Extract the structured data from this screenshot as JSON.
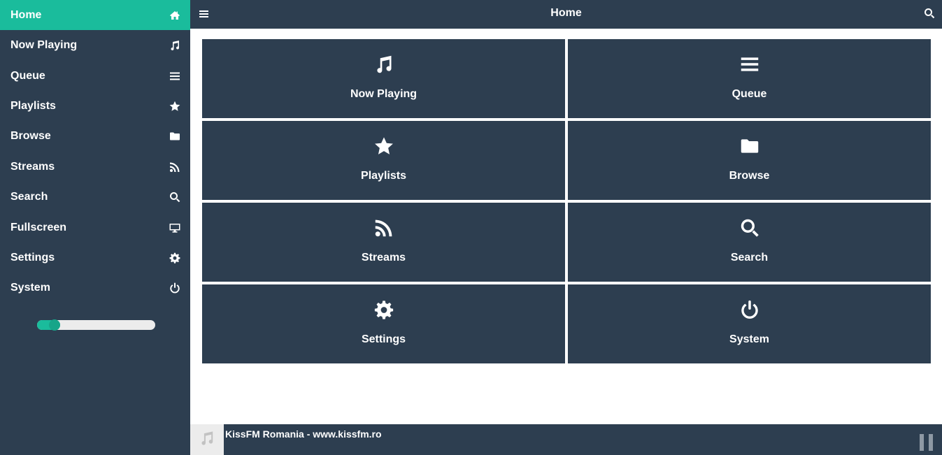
{
  "sidebar": {
    "items": [
      {
        "label": "Home",
        "icon": "home-icon",
        "active": true
      },
      {
        "label": "Now Playing",
        "icon": "music-icon"
      },
      {
        "label": "Queue",
        "icon": "list-icon"
      },
      {
        "label": "Playlists",
        "icon": "star-icon"
      },
      {
        "label": "Browse",
        "icon": "folder-icon"
      },
      {
        "label": "Streams",
        "icon": "rss-icon"
      },
      {
        "label": "Search",
        "icon": "search-icon"
      },
      {
        "label": "Fullscreen",
        "icon": "desktop-icon"
      },
      {
        "label": "Settings",
        "icon": "gear-icon"
      },
      {
        "label": "System",
        "icon": "power-icon"
      }
    ],
    "volume": 0.15
  },
  "header": {
    "title": "Home",
    "menu_icon": "hamburger-icon",
    "search_icon": "search-icon"
  },
  "tiles": [
    {
      "label": "Now Playing",
      "icon": "music-icon"
    },
    {
      "label": "Queue",
      "icon": "list-icon"
    },
    {
      "label": "Playlists",
      "icon": "star-icon"
    },
    {
      "label": "Browse",
      "icon": "folder-icon"
    },
    {
      "label": "Streams",
      "icon": "rss-icon"
    },
    {
      "label": "Search",
      "icon": "search-icon"
    },
    {
      "label": "Settings",
      "icon": "gear-icon"
    },
    {
      "label": "System",
      "icon": "power-icon"
    }
  ],
  "footer": {
    "track": "KissFM Romania - www.kissfm.ro",
    "cover_icon": "music-icon",
    "control_icon": "pause-icon"
  },
  "colors": {
    "primary": "#2d3e50",
    "accent": "#1abc9c",
    "background": "#ffffff"
  }
}
